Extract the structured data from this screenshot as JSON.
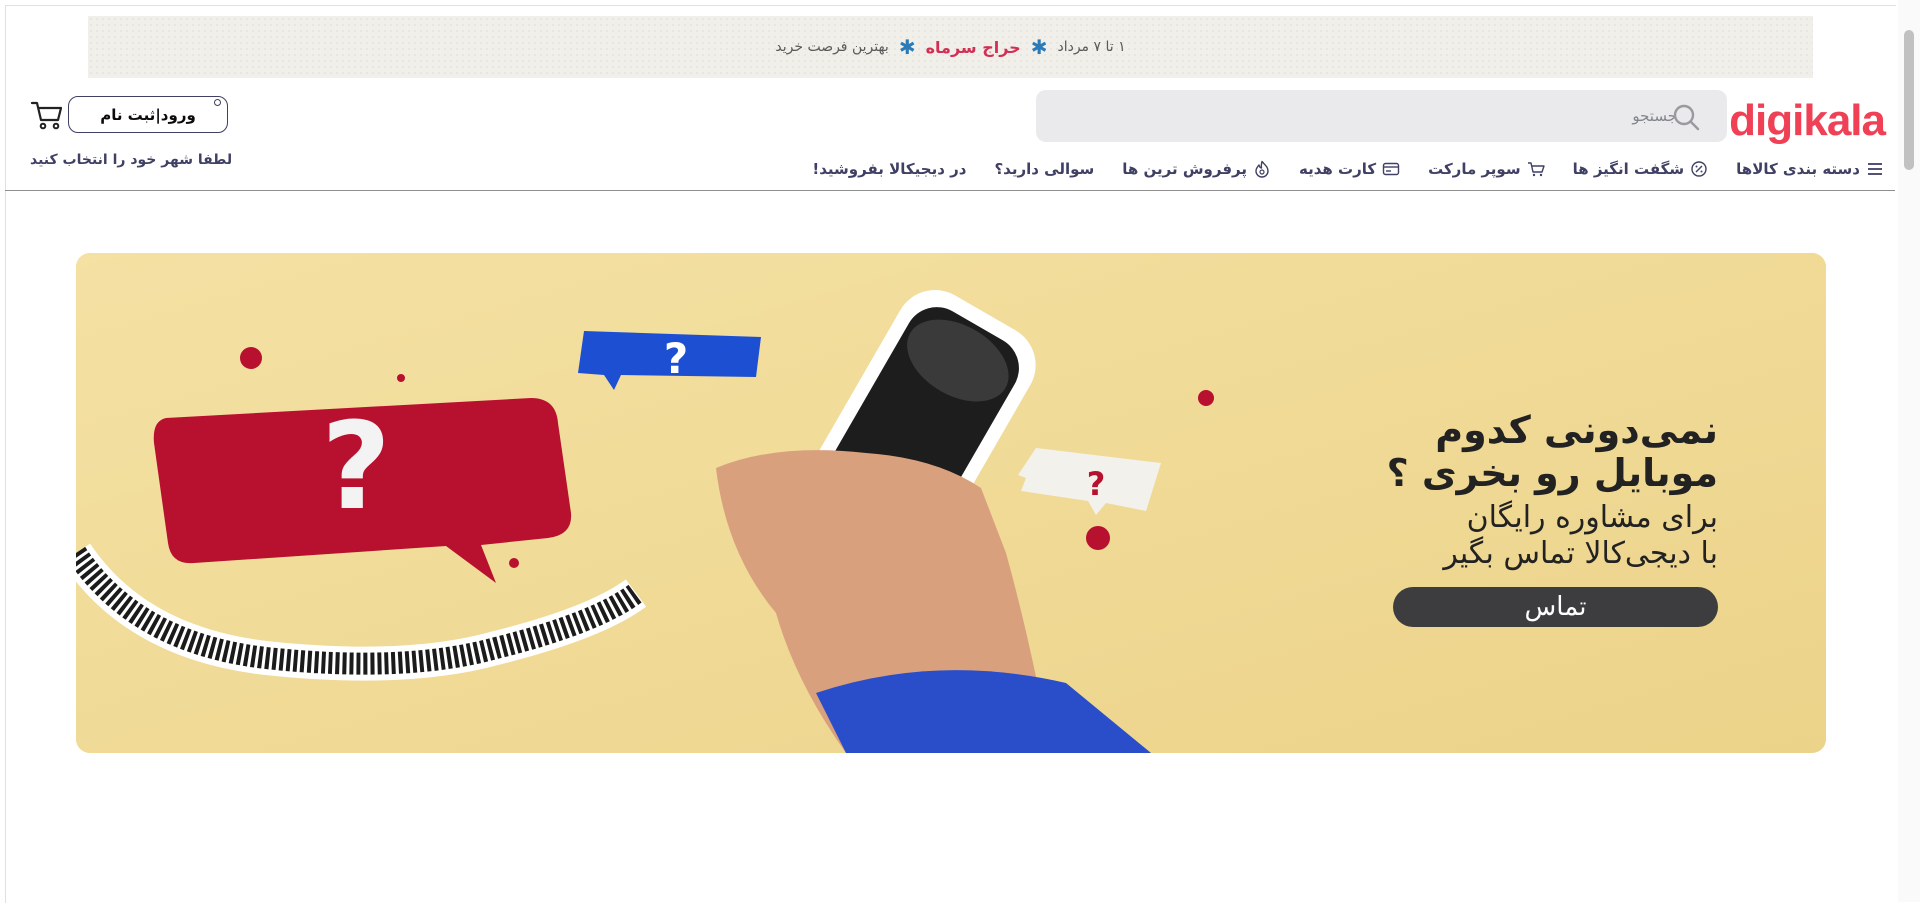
{
  "promo": {
    "dates": "۱ تا ۷ مرداد",
    "sale_label": "حراج سرماه",
    "tagline": "بهترین فرصت خرید"
  },
  "header": {
    "logo": "digikala",
    "search_placeholder": "جستجو",
    "login_label": "ورود|ثبت نام",
    "city_prompt": "لطفا شهر خود را انتخاب کنید"
  },
  "nav": {
    "items": [
      {
        "label": "دسته بندی کالاها",
        "icon": "menu-icon"
      },
      {
        "label": "شگفت انگیز ها",
        "icon": "discount-icon"
      },
      {
        "label": "سوپر مارکت",
        "icon": "basket-icon"
      },
      {
        "label": "کارت هدیه",
        "icon": "gift-card-icon"
      },
      {
        "label": "پرفروش ترین ها",
        "icon": "fire-icon"
      },
      {
        "label": "سوالی دارید؟",
        "icon": ""
      },
      {
        "label": "در دیجیکالا بفروشید!",
        "icon": ""
      }
    ]
  },
  "banner": {
    "line1": "نمی‌دونی کدوم",
    "line2": "موبایل رو بخری ؟",
    "line3": "برای مشاوره رایگان",
    "line4": "با دیجی‌کالا تماس بگیر",
    "cta": "تماس"
  },
  "colors": {
    "brand": "#ef4056",
    "banner_bg": "#f2dc97",
    "sale": "#d32f55"
  }
}
